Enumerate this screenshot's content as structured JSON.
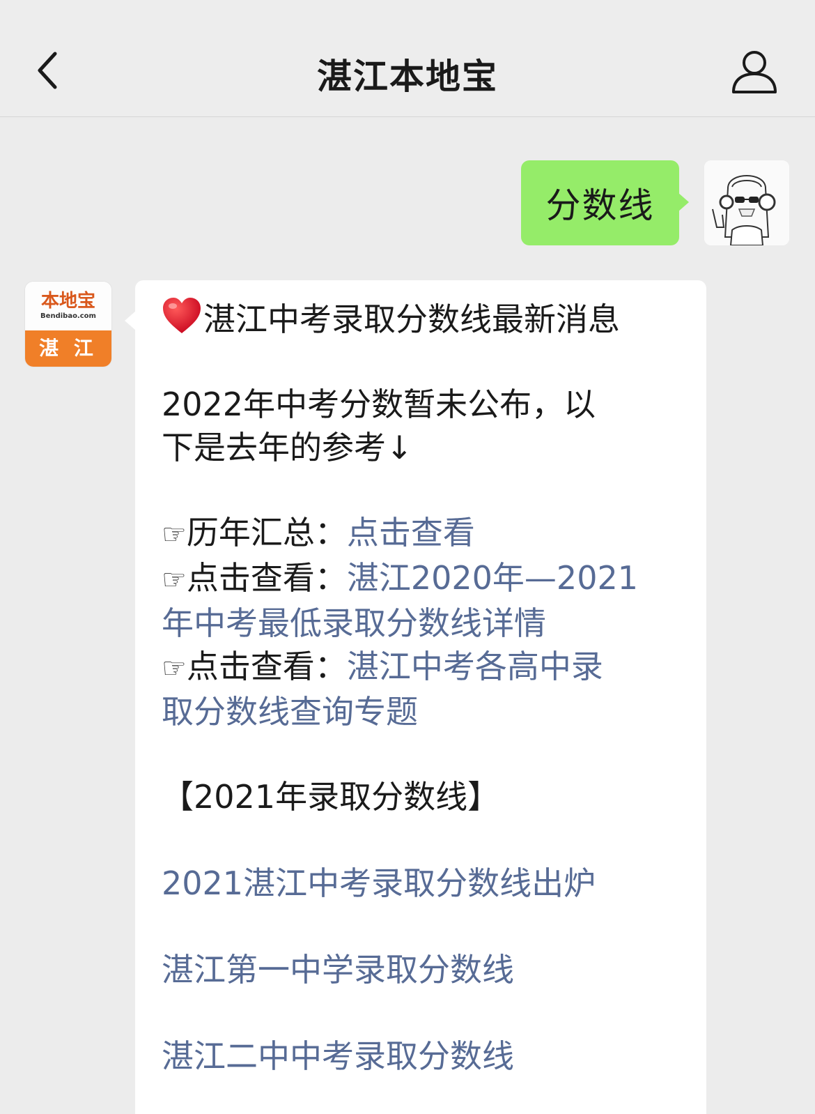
{
  "nav": {
    "title": "湛江本地宝"
  },
  "chat": {
    "user_message": "分数线",
    "bot_avatar": {
      "logo_text": "本地宝",
      "url_text": "Bendibao.com",
      "city_text": "湛 江"
    },
    "reply": {
      "heading": "湛江中考录取分数线最新消息",
      "intro_line1": "2022年中考分数暂未公布，以",
      "intro_line2": "下是去年的参考↓",
      "hand_glyph": "☞",
      "item1_label": "历年汇总：",
      "item1_link": "点击查看",
      "item2_label": "点击查看：",
      "item2_link_line1": "湛江2020年—2021",
      "item2_link_line2": "年中考最低录取分数线详情",
      "item3_label": "点击查看：",
      "item3_link_line1": "湛江中考各高中录",
      "item3_link_line2": "取分数线查询专题",
      "section_title": "【2021年录取分数线】",
      "link_a": "2021湛江中考录取分数线出炉",
      "link_b": "湛江第一中学录取分数线",
      "link_c": "湛江二中中考录取分数线"
    }
  },
  "colors": {
    "link": "#576b95",
    "user_bubble": "#95ec69",
    "background": "#ececec"
  },
  "icons": [
    "chevron-left-icon",
    "person-icon",
    "heart-icon",
    "pointing-hand-icon"
  ]
}
